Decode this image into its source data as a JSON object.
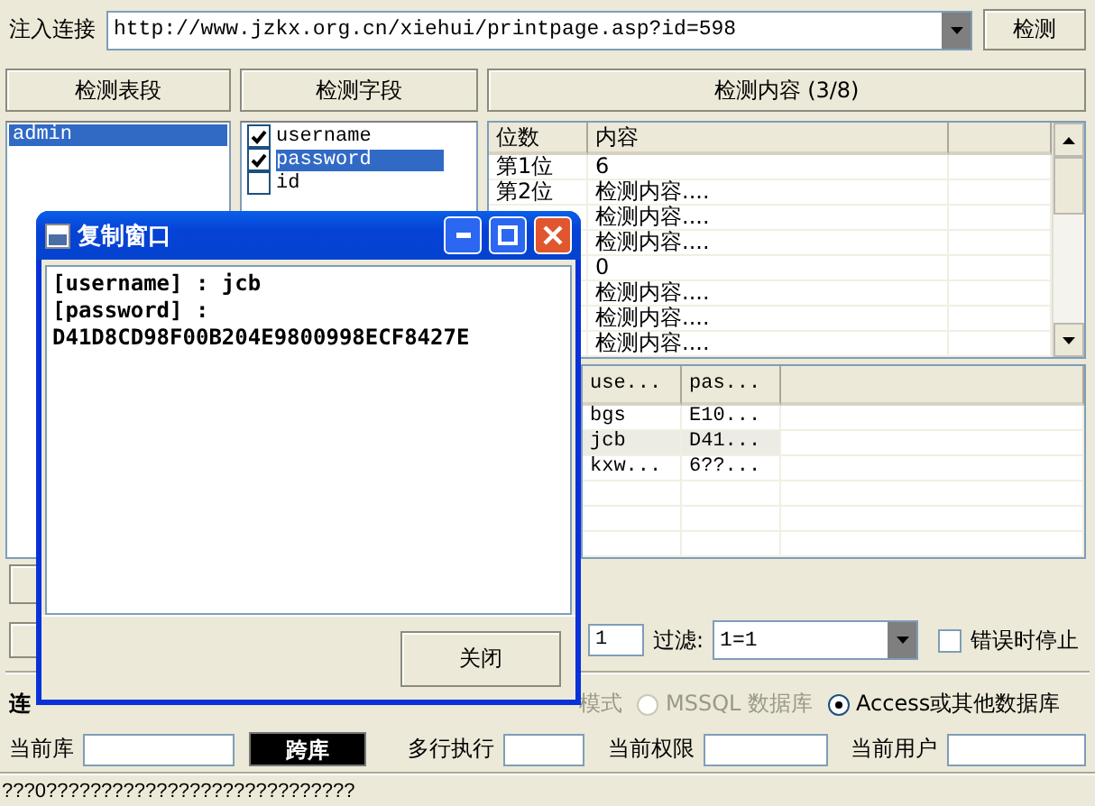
{
  "injection": {
    "label": "注入连接",
    "url": "http://www.jzkx.org.cn/xiehui/printpage.asp?id=598",
    "button": "检测"
  },
  "headers": [
    "检测表段",
    "检测字段",
    "检测内容 (3/8)"
  ],
  "tables_list": [
    {
      "name": "admin",
      "selected": true
    }
  ],
  "fields_list": [
    {
      "name": "username",
      "checked": true,
      "selected": false
    },
    {
      "name": "password",
      "checked": true,
      "selected": true
    },
    {
      "name": "id",
      "checked": false,
      "selected": false
    }
  ],
  "content_table": {
    "columns": [
      "位数",
      "内容"
    ],
    "rows": [
      {
        "position": "第1位",
        "value": "6"
      },
      {
        "position": "第2位",
        "value": "检测内容...."
      },
      {
        "value": "检测内容...."
      },
      {
        "value": "检测内容...."
      },
      {
        "value": "0"
      },
      {
        "value": "检测内容...."
      },
      {
        "value": "检测内容...."
      },
      {
        "value": "检测内容...."
      }
    ]
  },
  "results_table": {
    "columns": [
      "use...",
      "pas..."
    ],
    "rows": [
      {
        "cells": [
          "bgs",
          "E10..."
        ],
        "selected": false
      },
      {
        "cells": [
          "jcb",
          "D41..."
        ],
        "selected": true
      },
      {
        "cells": [
          "kxw...",
          "6??..."
        ],
        "selected": false
      }
    ]
  },
  "options": {
    "count_value": "1",
    "filter_label": "过滤:",
    "filter_value": "1=1",
    "stop_on_error": {
      "label": "错误时停止",
      "checked": false
    }
  },
  "connection": {
    "label": "连",
    "mode_fragment": "模式",
    "databases": [
      {
        "label": "MSSQL 数据库",
        "selected": false,
        "disabled": true
      },
      {
        "label": "Access或其他数据库",
        "selected": true,
        "disabled": false
      }
    ]
  },
  "info": {
    "current_db": "当前库",
    "cross_db_button": "跨库",
    "multi_exec": "多行执行",
    "privilege": "当前权限",
    "user": "当前用户"
  },
  "status_bar": "???0????????????????????????????",
  "dialog": {
    "title": "复制窗口",
    "lines": [
      "[username] : jcb",
      "[password] :",
      "D41D8CD98F00B204E9800998ECF8427E"
    ],
    "close_button": "关闭"
  }
}
